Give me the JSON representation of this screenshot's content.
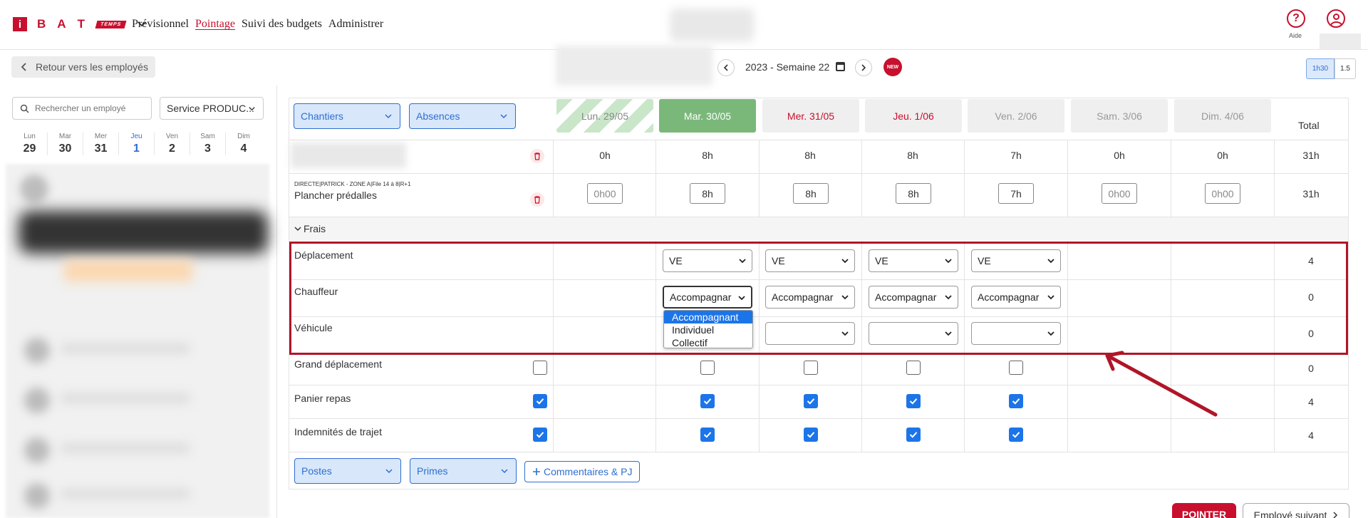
{
  "header": {
    "logo_letters": [
      "B",
      "A",
      "T"
    ],
    "logo_i": "i",
    "logo_badge": "TEMPS",
    "nav": [
      "Prévisionnel",
      "Pointage",
      "Suivi des budgets",
      "Administrer"
    ],
    "active_nav": "Pointage",
    "help_label": "Aide",
    "help_glyph": "?"
  },
  "subbar": {
    "back_label": "Retour vers les employés",
    "week_label": "2023 - Semaine 22",
    "new_badge": "NEW",
    "scale_options": [
      "1h30",
      "1.5"
    ],
    "scale_selected": "1h30"
  },
  "left": {
    "search_placeholder": "Rechercher un employé",
    "service_label": "Service PRODUC...",
    "days": [
      {
        "name": "Lun",
        "num": "29"
      },
      {
        "name": "Mar",
        "num": "30"
      },
      {
        "name": "Mer",
        "num": "31"
      },
      {
        "name": "Jeu",
        "num": "1"
      },
      {
        "name": "Ven",
        "num": "2"
      },
      {
        "name": "Sam",
        "num": "3"
      },
      {
        "name": "Dim",
        "num": "4"
      }
    ],
    "today_index": 3
  },
  "main": {
    "dropdowns": {
      "chantiers": "Chantiers",
      "absences": "Absences",
      "postes": "Postes",
      "primes": "Primes"
    },
    "day_headers": [
      "Lun. 29/05",
      "Mar. 30/05",
      "Mer. 31/05",
      "Jeu. 1/06",
      "Ven. 2/06",
      "Sam. 3/06",
      "Dim. 4/06"
    ],
    "total_label": "Total",
    "summary_row": {
      "values": [
        "0h",
        "8h",
        "8h",
        "8h",
        "7h",
        "0h",
        "0h"
      ],
      "total": "31h"
    },
    "task_row": {
      "subtitle": "DIRECTE|PATRICK - ZONE A|File 14 à 8|R+1",
      "title": "Plancher prédalles",
      "values": [
        "0h00",
        "8h",
        "8h",
        "8h",
        "7h",
        "0h00",
        "0h00"
      ],
      "total": "31h"
    },
    "frais_label": "Frais",
    "frais_rows": {
      "deplacement": {
        "label": "Déplacement",
        "values": [
          "VE",
          "VE",
          "VE",
          "VE"
        ],
        "total": "4"
      },
      "chauffeur": {
        "label": "Chauffeur",
        "values": [
          "Accompagnar",
          "Accompagnar",
          "Accompagnar",
          "Accompagnar"
        ],
        "total": "0"
      },
      "vehicule": {
        "label": "Véhicule",
        "total": "0"
      }
    },
    "chauffeur_options": [
      "Accompagnant",
      "Individuel",
      "Collectif"
    ],
    "chauffeur_highlight": "Accompagnant",
    "checkbox_rows": [
      {
        "label": "Grand déplacement",
        "checked": [
          false,
          false,
          false,
          false,
          false
        ],
        "total": "0"
      },
      {
        "label": "Panier repas",
        "checked": [
          true,
          true,
          true,
          true,
          true
        ],
        "total": "4"
      },
      {
        "label": "Indemnités de trajet",
        "checked": [
          true,
          true,
          true,
          true,
          true
        ],
        "total": "4"
      }
    ],
    "comments_label": "Commentaires & PJ",
    "pointer_label": "POINTER",
    "next_label": "Employé suivant"
  },
  "colors": {
    "brand": "#c8102e",
    "accent": "#2f6fd0",
    "today": "#7ab87a",
    "annotation": "#b01528"
  }
}
